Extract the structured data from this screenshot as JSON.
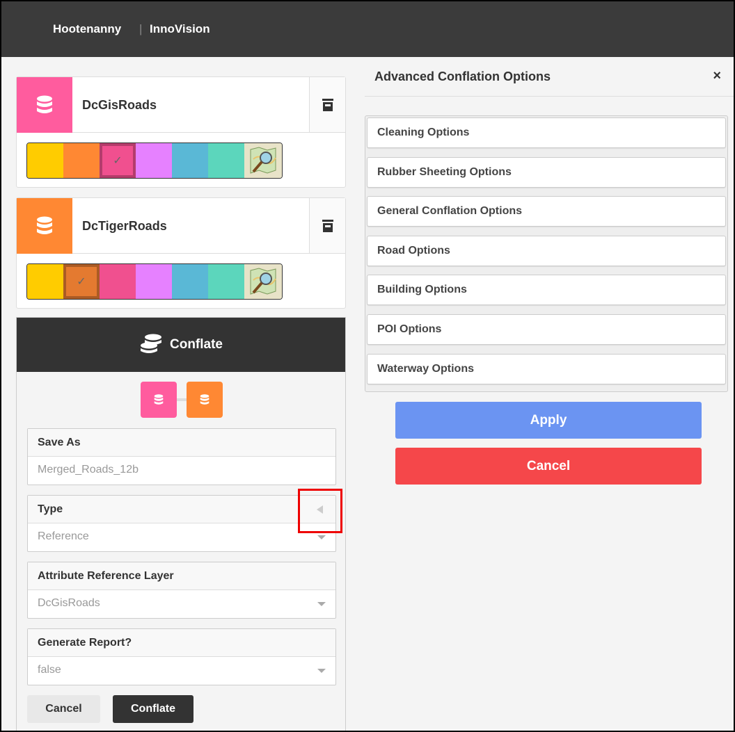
{
  "header": {
    "brand": "Hootenanny",
    "separator": "|",
    "product": "InnoVision"
  },
  "layers": [
    {
      "name": "DcGisRoads",
      "color": "#ff5c9e",
      "swatches": [
        "#ffcc00",
        "#ff8833",
        "#f0508f",
        "#e681ff",
        "#5ab8d6",
        "#5cd6bc"
      ],
      "selected_index": 2
    },
    {
      "name": "DcTigerRoads",
      "color": "#ff8833",
      "swatches": [
        "#ffcc00",
        "#e47a30",
        "#f0508f",
        "#e681ff",
        "#5ab8d6",
        "#5cd6bc"
      ],
      "selected_index": 1
    }
  ],
  "conflate": {
    "title": "Conflate",
    "fields": {
      "save_as": {
        "label": "Save As",
        "value": "Merged_Roads_12b"
      },
      "type": {
        "label": "Type",
        "value": "Reference"
      },
      "attr_ref": {
        "label": "Attribute Reference Layer",
        "value": "DcGisRoads"
      },
      "report": {
        "label": "Generate Report?",
        "value": "false"
      }
    },
    "cancel_label": "Cancel",
    "conflate_label": "Conflate"
  },
  "advanced": {
    "title": "Advanced Conflation Options",
    "close": "×",
    "options": [
      "Cleaning Options",
      "Rubber Sheeting Options",
      "General Conflation Options",
      "Road Options",
      "Building Options",
      "POI Options",
      "Waterway Options"
    ],
    "apply_label": "Apply",
    "cancel_label": "Cancel"
  },
  "colors": {
    "apply": "#6b94f2",
    "cancel": "#f5474a",
    "dark": "#333333"
  }
}
